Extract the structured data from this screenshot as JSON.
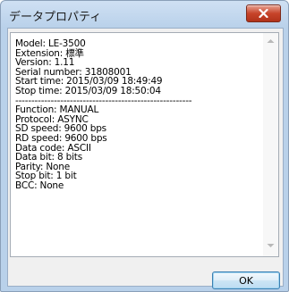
{
  "window": {
    "title": "データプロパティ"
  },
  "properties": {
    "lines": [
      "Model: LE-3500",
      "Extension: 標準",
      "Version: 1.11",
      "Serial number: 31808001",
      "Start time: 2015/03/09 18:49:49",
      "Stop time: 2015/03/09 18:50:04",
      "-------------------------------------------------------",
      "Function: MANUAL",
      "Protocol: ASYNC",
      "SD speed: 9600 bps",
      "RD speed: 9600 bps",
      "Data code: ASCII",
      "Data bit: 8 bits",
      "Parity: None",
      "Stop bit: 1 bit",
      "BCC: None"
    ]
  },
  "buttons": {
    "ok_label": "OK"
  },
  "icons": {
    "close": "close-icon",
    "scroll_up": "chevron-up-icon",
    "scroll_down": "chevron-down-icon"
  }
}
